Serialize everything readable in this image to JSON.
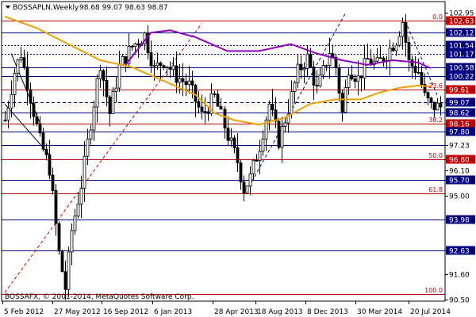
{
  "chart_data": {
    "type": "candlestick",
    "symbol": "BOSSAPLN",
    "header": {
      "symbol_label": "BOSSAPLN,Weekly",
      "quote": "98.68 99.07 98.63 98.87"
    },
    "copyright": "BOSSAFX, © 2001-2014, MetaQuotes Software Corp.",
    "ylim": [
      90.5,
      103.0
    ],
    "y_ticks": [
      "102.95",
      "102.63",
      "102.12",
      "101.54",
      "101.17",
      "100.58",
      "100.22",
      "99.61",
      "99.07",
      "98.62",
      "98.16",
      "97.80",
      "97.23",
      "96.60",
      "96.10",
      "95.70",
      "95.00",
      "93.98",
      "92.63",
      "91.60",
      "90.50"
    ],
    "x_ticks": [
      "5 Feb 2012",
      "27 May 2012",
      "16 Sep 2012",
      "6 Jan 2013",
      "28 Apr 2013",
      "18 Aug 2013",
      "8 Dec 2013",
      "30 Mar 2014",
      "20 Jul 2014"
    ],
    "fib_levels": [
      {
        "label": "0.0",
        "price": 102.63
      },
      {
        "label": "23.6",
        "price": 99.61
      },
      {
        "label": "38.2",
        "price": 98.16
      },
      {
        "label": "50.0",
        "price": 96.6
      },
      {
        "label": "61.8",
        "price": 95.1
      },
      {
        "label": "100.0",
        "price": 90.75
      }
    ],
    "horizontal_levels": [
      {
        "price": 102.63,
        "color": "#c00000",
        "style": "solid"
      },
      {
        "price": 102.12,
        "color": "#000080",
        "style": "solid"
      },
      {
        "price": 101.54,
        "color": "#000080",
        "style": "dotted"
      },
      {
        "price": 101.17,
        "color": "#000080",
        "style": "dotted"
      },
      {
        "price": 100.58,
        "color": "#000080",
        "style": "solid"
      },
      {
        "price": 100.22,
        "color": "#000080",
        "style": "solid"
      },
      {
        "price": 99.61,
        "color": "#c00000",
        "style": "solid"
      },
      {
        "price": 99.07,
        "color": "#000080",
        "style": "dashed"
      },
      {
        "price": 98.62,
        "color": "#000080",
        "style": "solid"
      },
      {
        "price": 98.16,
        "color": "#c00000",
        "style": "solid"
      },
      {
        "price": 97.8,
        "color": "#000080",
        "style": "solid"
      },
      {
        "price": 97.23,
        "color": "#000080",
        "style": "solid"
      },
      {
        "price": 96.6,
        "color": "#c00000",
        "style": "solid"
      },
      {
        "price": 95.7,
        "color": "#000080",
        "style": "solid"
      },
      {
        "price": 95.1,
        "color": "#c00000",
        "style": "solid"
      },
      {
        "price": 93.98,
        "color": "#000080",
        "style": "solid"
      },
      {
        "price": 92.63,
        "color": "#000080",
        "style": "solid"
      },
      {
        "price": 90.75,
        "color": "#c00000",
        "style": "solid"
      }
    ],
    "axis_price_tags": [
      "102.63",
      "102.12",
      "101.54",
      "101.17",
      "100.58",
      "100.22",
      "99.61",
      "99.07",
      "98.62",
      "98.16",
      "97.80",
      "96.60",
      "95.70",
      "93.98",
      "92.63"
    ],
    "candle_count": 138,
    "candle_seed": 7,
    "ohlc_anchors": [
      [
        0,
        98.3
      ],
      [
        3,
        100.4
      ],
      [
        5,
        101.2
      ],
      [
        8,
        99.3
      ],
      [
        11,
        97.4
      ],
      [
        14,
        96.2
      ],
      [
        17,
        92.5
      ],
      [
        19,
        91.0
      ],
      [
        21,
        93.5
      ],
      [
        24,
        95.5
      ],
      [
        27,
        98.2
      ],
      [
        30,
        100.8
      ],
      [
        33,
        98.6
      ],
      [
        36,
        100.6
      ],
      [
        40,
        101.5
      ],
      [
        44,
        102.0
      ],
      [
        47,
        100.5
      ],
      [
        50,
        100.9
      ],
      [
        54,
        100.2
      ],
      [
        58,
        99.8
      ],
      [
        62,
        98.5
      ],
      [
        66,
        99.3
      ],
      [
        70,
        97.6
      ],
      [
        73,
        96.5
      ],
      [
        75,
        95.3
      ],
      [
        77,
        95.8
      ],
      [
        80,
        97.2
      ],
      [
        83,
        99.0
      ],
      [
        86,
        97.4
      ],
      [
        89,
        98.8
      ],
      [
        92,
        100.4
      ],
      [
        95,
        101.0
      ],
      [
        98,
        99.6
      ],
      [
        100,
        100.4
      ],
      [
        102,
        101.3
      ],
      [
        104,
        100.6
      ],
      [
        106,
        98.6
      ],
      [
        108,
        100.6
      ],
      [
        111,
        100.1
      ],
      [
        114,
        100.9
      ],
      [
        117,
        100.7
      ],
      [
        120,
        101.2
      ],
      [
        123,
        101.8
      ],
      [
        125,
        102.6
      ],
      [
        127,
        100.8
      ],
      [
        130,
        100.4
      ],
      [
        132,
        99.3
      ],
      [
        134,
        98.9
      ],
      [
        137,
        98.87
      ]
    ],
    "series": [
      {
        "kind": "moving-average",
        "color": "#f0a000",
        "anchors": [
          [
            0,
            102.8
          ],
          [
            10,
            102.3
          ],
          [
            20,
            101.6
          ],
          [
            30,
            100.9
          ],
          [
            40,
            100.6
          ],
          [
            50,
            100.0
          ],
          [
            60,
            99.4
          ],
          [
            66,
            98.6
          ],
          [
            72,
            98.3
          ],
          [
            80,
            98.1
          ],
          [
            88,
            98.4
          ],
          [
            96,
            99.0
          ],
          [
            104,
            99.2
          ],
          [
            112,
            99.2
          ],
          [
            118,
            99.5
          ],
          [
            124,
            99.7
          ],
          [
            130,
            99.8
          ],
          [
            134,
            99.75
          ]
        ]
      },
      {
        "kind": "moving-average",
        "color": "#9000c0",
        "anchors": [
          [
            38,
            100.7
          ],
          [
            46,
            102.1
          ],
          [
            52,
            102.2
          ],
          [
            60,
            101.9
          ],
          [
            70,
            101.3
          ],
          [
            80,
            101.3
          ],
          [
            90,
            101.6
          ],
          [
            98,
            101.2
          ],
          [
            106,
            100.9
          ],
          [
            114,
            100.7
          ],
          [
            122,
            100.9
          ],
          [
            130,
            100.8
          ],
          [
            134,
            100.55
          ]
        ]
      }
    ],
    "trendlines": [
      {
        "color": "#000000",
        "style": "solid",
        "from": [
          2,
          101.2
        ],
        "to": [
          11,
          98.2
        ]
      },
      {
        "color": "#000000",
        "style": "solid",
        "from": [
          0,
          99.0
        ],
        "to": [
          14,
          96.8
        ]
      },
      {
        "color": "#c00000",
        "style": "dashed",
        "from": [
          0,
          90.8
        ],
        "to": [
          62,
          102.5
        ]
      },
      {
        "color": "#000080",
        "style": "dashed",
        "from": [
          76,
          95.2
        ],
        "to": [
          107,
          102.9
        ]
      },
      {
        "color": "#000080",
        "style": "dashed",
        "from": [
          126,
          102.6
        ],
        "to": [
          136,
          99.4
        ]
      }
    ]
  }
}
